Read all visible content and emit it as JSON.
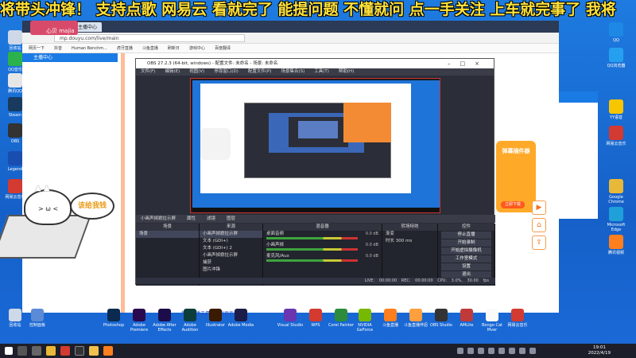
{
  "danmaku": "将带头冲锋！ 支持点歌 网易云 看就完了 能提问题 不懂就问 点一手关注 上车就完事了 我将",
  "webcam_label": "心贝 majia",
  "browser": {
    "tab_title": "主播中心",
    "address": "mp.douyu.com/live/main",
    "bookmarks": [
      "网页一下",
      "抖音",
      "Human Benchm...",
      "虎牙直播",
      "斗鱼直播",
      "刷新日",
      "游戏中心",
      "百度翻译"
    ],
    "sidebar_header": "主播中心",
    "promo_title": "弹幕插件器",
    "promo_button": "立即下载",
    "bottom_text": "新版直播工具，下载更有趣"
  },
  "obs": {
    "title": "OBS 27.2.3 (64-bit, windows) - 配置文件: 未命名 - 场景: 未命名",
    "menu": [
      "文件(F)",
      "编辑(E)",
      "视图(V)",
      "停靠窗口(D)",
      "配置文件(P)",
      "场景集合(S)",
      "工具(T)",
      "帮助(H)"
    ],
    "scene_bar": [
      "小画声掉掀拉示屏",
      "属性",
      "滤镜",
      "图层"
    ],
    "scenes_header": "场景",
    "scenes": [
      "场景"
    ],
    "sources_header": "来源",
    "sources": [
      "小画声掉掀拉示屏",
      "文本 (GDI+)",
      "文本 (GDI+) 2",
      "小画声掉掀拉示屏",
      "捕获",
      "图片冲锋"
    ],
    "mixer_header": "混音器",
    "mixer": [
      {
        "name": "桌面音频",
        "db": "0.0 dB"
      },
      {
        "name": "小画声掉",
        "db": "0.0 dB"
      },
      {
        "name": "麦克风/Aux",
        "db": "0.0 dB"
      }
    ],
    "transition_header": "转场特效",
    "transition_value": "渐变",
    "duration_label": "时长",
    "duration_value": "300 ms",
    "controls_header": "控件",
    "controls": [
      "停止直播",
      "开始录制",
      "开始虚拟摄像机",
      "工作室模式",
      "设置",
      "退出"
    ],
    "status": "LIVE: 00:00:00   REC: 00:00:00   CPU: 3.0%, 30.00 fps"
  },
  "speech_bubble": "该给我钱",
  "desktop_icons": [
    "回收站",
    "QQ音乐",
    "腾讯QQ",
    "Steam",
    "OBS",
    "Legend",
    "网易云音乐",
    "新建文件夹"
  ],
  "right_icons": [
    "QQ",
    "QQ浏览器",
    "YY语音",
    "网易云音乐",
    "Google Chrome",
    "Microsoft Edge",
    "腾讯视频"
  ],
  "taskbar_icons": [
    "回收站",
    "控制面板",
    "Photoshop",
    "Adobe Premiere",
    "Adobe After Effects",
    "Adobe Audition",
    "Illustrator",
    "Adobe Media",
    "Visual Studio",
    "WPS",
    "Corel Painter",
    "NVIDIA GeForce",
    "斗鱼直播",
    "斗鱼直播伴侣",
    "OBS Studio",
    "AMLite",
    "Bongo Cat Mver",
    "网易云音乐"
  ],
  "clock": {
    "time": "19:01",
    "date": "2022/4/19"
  }
}
